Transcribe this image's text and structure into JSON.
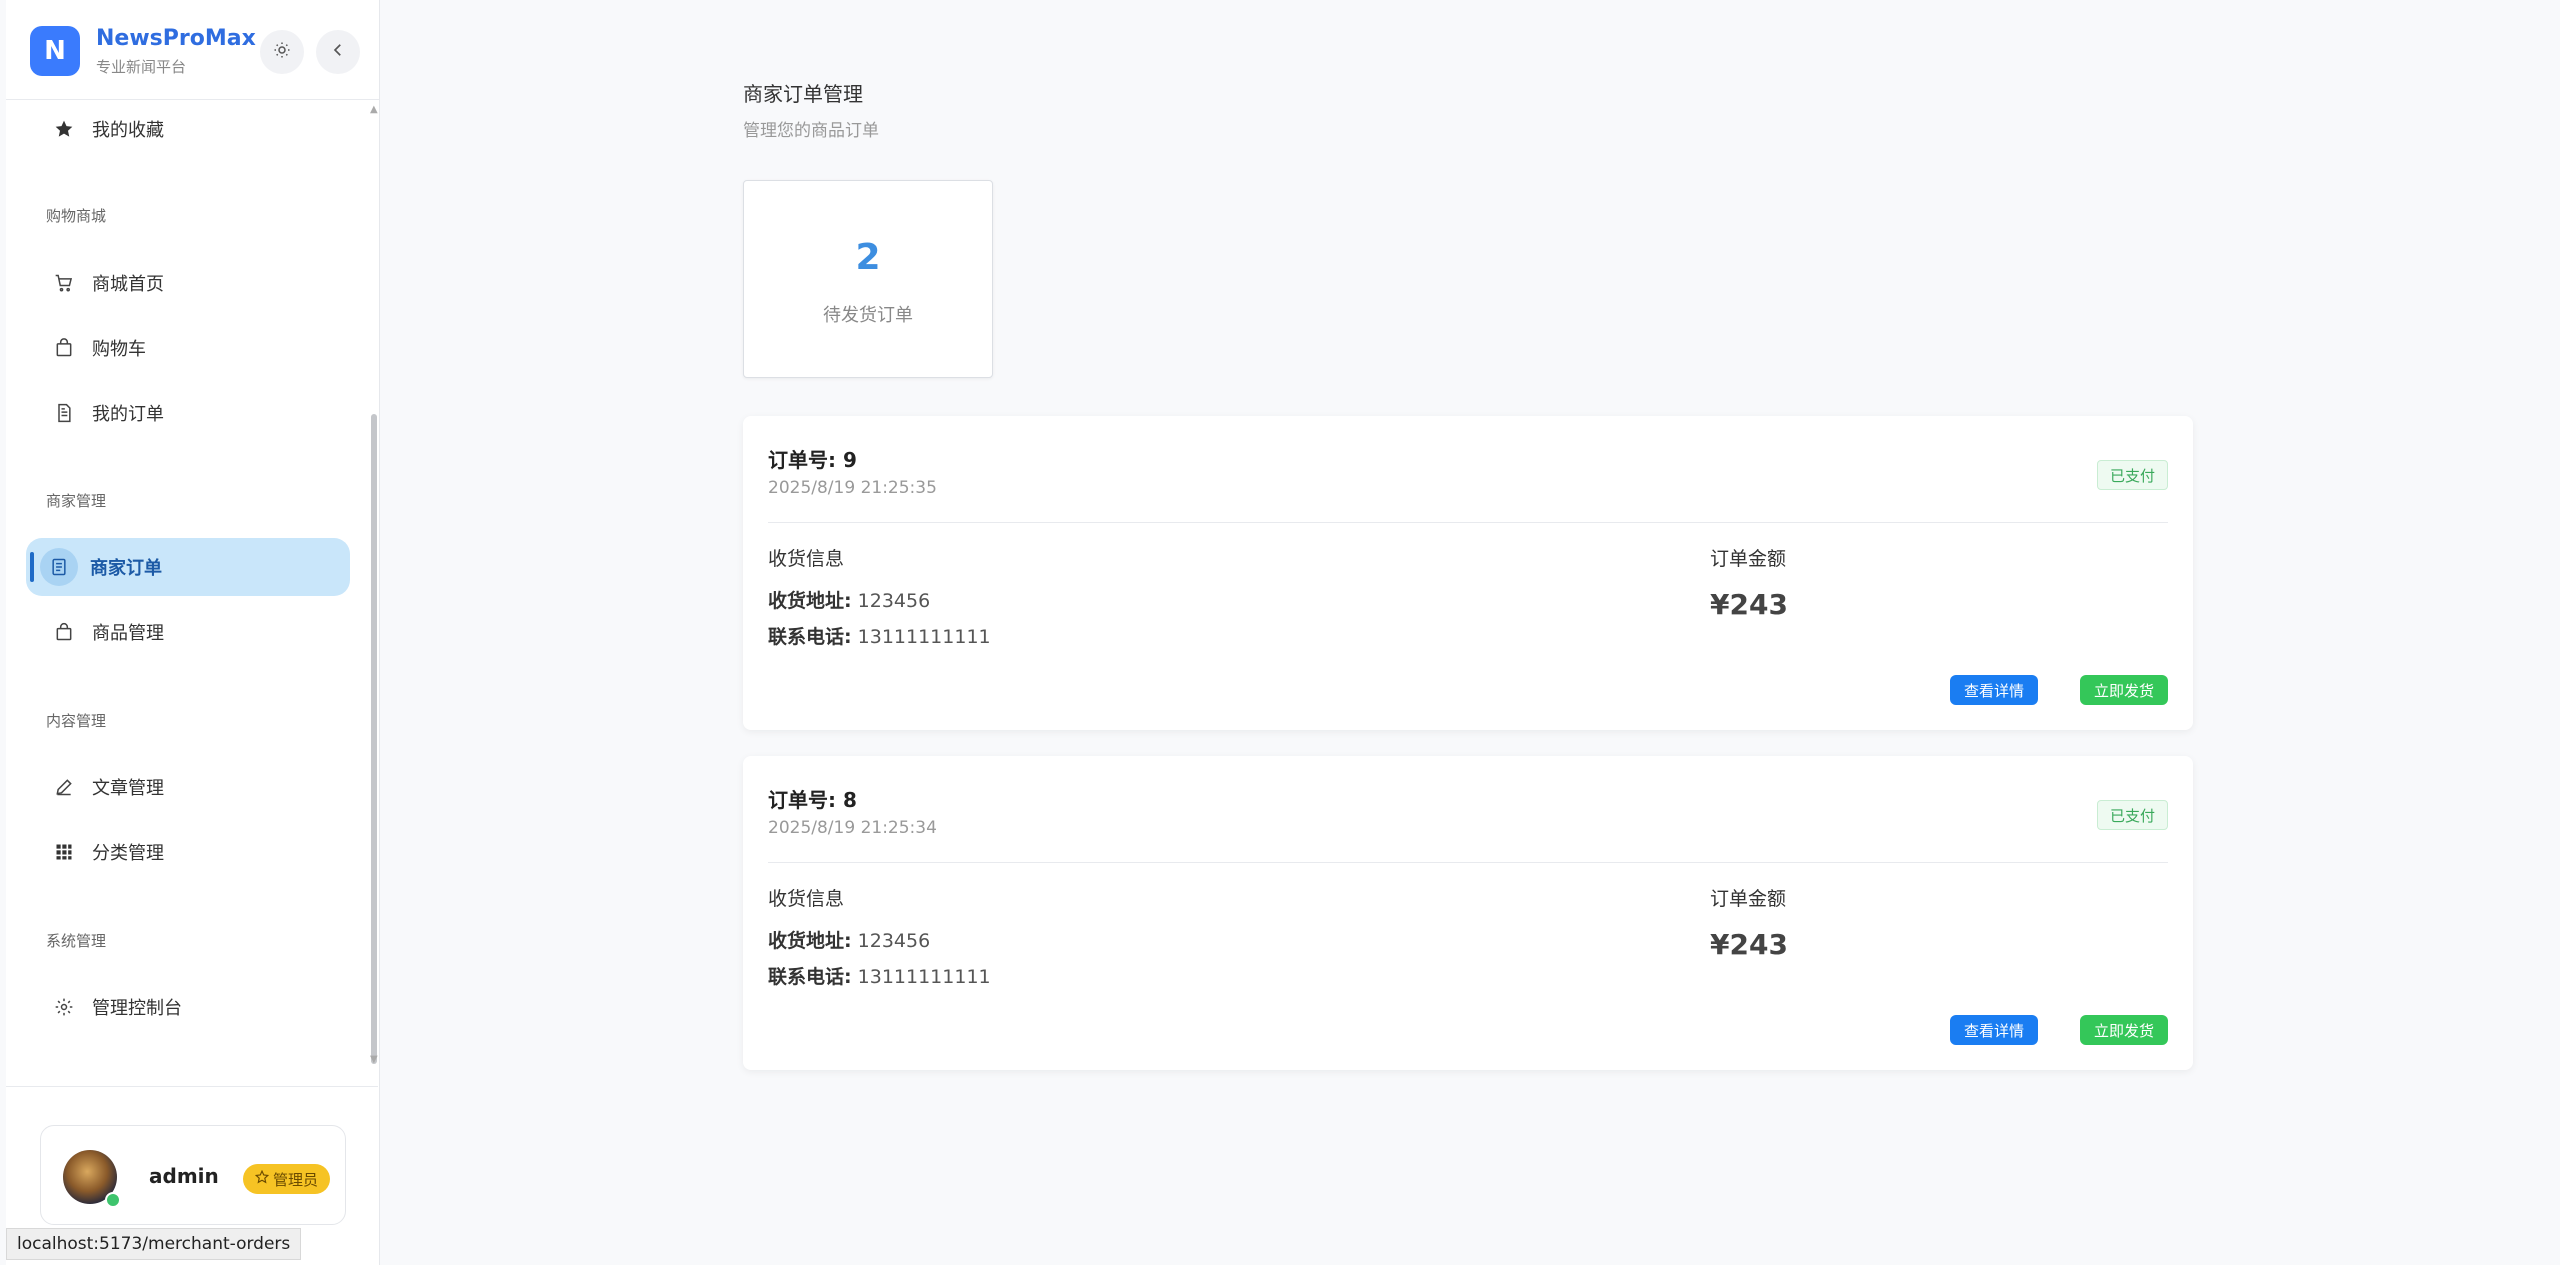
{
  "sidebar": {
    "logo_letter": "N",
    "brand_name": "NewsProMax",
    "brand_sub": "专业新闻平台",
    "favorites": "我的收藏",
    "group_shop": "购物商城",
    "shop_home": "商城首页",
    "cart": "购物车",
    "my_orders": "我的订单",
    "group_merchant": "商家管理",
    "merchant_orders": "商家订单",
    "product_mgmt": "商品管理",
    "group_content": "内容管理",
    "article_mgmt": "文章管理",
    "category_mgmt": "分类管理",
    "group_system": "系统管理",
    "admin_console": "管理控制台"
  },
  "user": {
    "name": "admin",
    "role": "管理员"
  },
  "status_bar": {
    "url": "localhost:5173/merchant-orders"
  },
  "page": {
    "title": "商家订单管理",
    "subtitle": "管理您的商品订单"
  },
  "stats": {
    "pending_count": "2",
    "pending_label": "待发货订单"
  },
  "labels": {
    "shipping_info": "收货信息",
    "address_label": "收货地址:",
    "phone_label": "联系电话:",
    "amount_label": "订单金额",
    "view_detail": "查看详情",
    "ship_now": "立即发货"
  },
  "orders": [
    {
      "order_no": "订单号: 9",
      "time": "2025/8/19 21:25:35",
      "status": "已支付",
      "address": "123456",
      "phone": "13111111111",
      "amount": "¥243"
    },
    {
      "order_no": "订单号: 8",
      "time": "2025/8/19 21:25:34",
      "status": "已支付",
      "address": "123456",
      "phone": "13111111111",
      "amount": "¥243"
    }
  ],
  "colors": {
    "primary": "#3a7bfd",
    "active_bg": "#c9e6fa",
    "detail_button": "#1a7df2",
    "ship_button": "#34c759",
    "paid_tag": "#3aa95b",
    "role_badge": "#f6c324"
  }
}
